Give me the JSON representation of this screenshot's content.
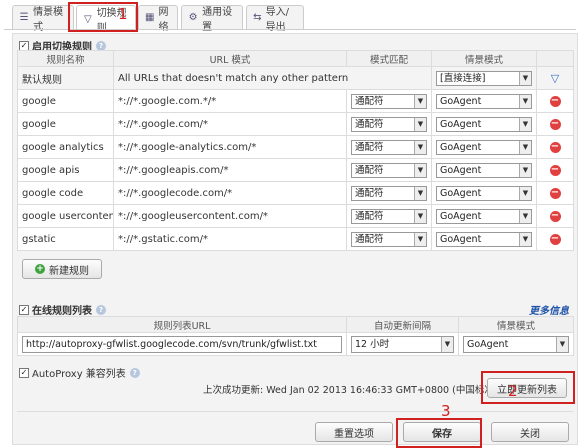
{
  "tabs": [
    {
      "label": "情景模式",
      "icon": "list-icon"
    },
    {
      "label": "切换规则",
      "icon": "filter-icon"
    },
    {
      "label": "网络",
      "icon": "network-icon"
    },
    {
      "label": "通用设置",
      "icon": "gear-icon"
    },
    {
      "label": "导入/导出",
      "icon": "import-export-icon"
    }
  ],
  "annotations": {
    "n1": "1",
    "n2": "2",
    "n3": "3"
  },
  "switch_rules": {
    "enable_label": "启用切换规则",
    "enabled": true,
    "columns": {
      "name": "规则名称",
      "url": "URL 模式",
      "match": "模式匹配",
      "profile": "情景模式"
    },
    "default_rule": {
      "name": "默认规则",
      "url": "All URLs that doesn't match any other pattern",
      "profile": "[直接连接]"
    },
    "rules": [
      {
        "name": "google",
        "url": "*://*.google.com.*/*",
        "match": "通配符",
        "profile": "GoAgent"
      },
      {
        "name": "google",
        "url": "*://*.google.com/*",
        "match": "通配符",
        "profile": "GoAgent"
      },
      {
        "name": "google analytics",
        "url": "*://*.google-analytics.com/*",
        "match": "通配符",
        "profile": "GoAgent"
      },
      {
        "name": "google apis",
        "url": "*://*.googleapis.com/*",
        "match": "通配符",
        "profile": "GoAgent"
      },
      {
        "name": "google code",
        "url": "*://*.googlecode.com/*",
        "match": "通配符",
        "profile": "GoAgent"
      },
      {
        "name": "google usercontent",
        "url": "*://*.googleusercontent.com/*",
        "match": "通配符",
        "profile": "GoAgent"
      },
      {
        "name": "gstatic",
        "url": "*://*.gstatic.com/*",
        "match": "通配符",
        "profile": "GoAgent"
      }
    ],
    "new_rule_label": "新建规则"
  },
  "online_rules": {
    "enable_label": "在线规则列表",
    "enabled": true,
    "more_info": "更多信息",
    "columns": {
      "url": "规则列表URL",
      "interval": "自动更新间隔",
      "profile": "情景模式"
    },
    "url": "http://autoproxy-gfwlist.googlecode.com/svn/trunk/gfwlist.txt",
    "interval": "12 小时",
    "profile": "GoAgent"
  },
  "autoproxy": {
    "label": "AutoProxy 兼容列表",
    "enabled": true
  },
  "last_update": "上次成功更新: Wed Jan 02 2013 16:46:33 GMT+0800 (中国标准时间)",
  "update_now_label": "立即更新列表",
  "footer": {
    "reset": "重置选项",
    "save": "保存",
    "close": "关闭"
  }
}
